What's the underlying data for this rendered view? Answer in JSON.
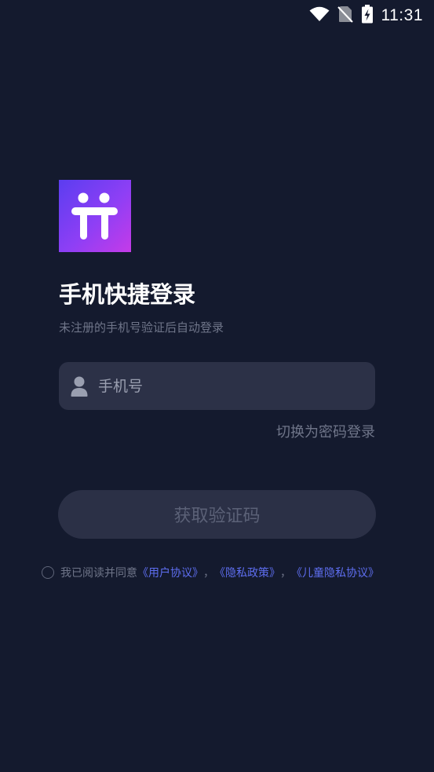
{
  "status_bar": {
    "time": "11:31",
    "icons": [
      "wifi-icon",
      "no-sim-icon",
      "battery-charging-icon"
    ]
  },
  "logo": {
    "icon": "tt-people-logo",
    "gradient_colors": [
      "#5b3df0",
      "#8e3ff5",
      "#c53be8"
    ]
  },
  "login": {
    "title": "手机快捷登录",
    "subtitle": "未注册的手机号验证后自动登录",
    "phone_placeholder": "手机号",
    "switch_label": "切换为密码登录",
    "get_code_label": "获取验证码"
  },
  "agreement": {
    "prefix": "我已阅读并同意",
    "user_agreement": "《用户协议》",
    "separator": "，",
    "privacy_policy": "《隐私政策》",
    "children_privacy": "《儿童隐私协议》",
    "link_color": "#5e6ef0"
  },
  "colors": {
    "background": "#141a2e",
    "input_bg": "#2c3147",
    "button_bg": "#2b3046",
    "muted_text": "#6f7589"
  }
}
